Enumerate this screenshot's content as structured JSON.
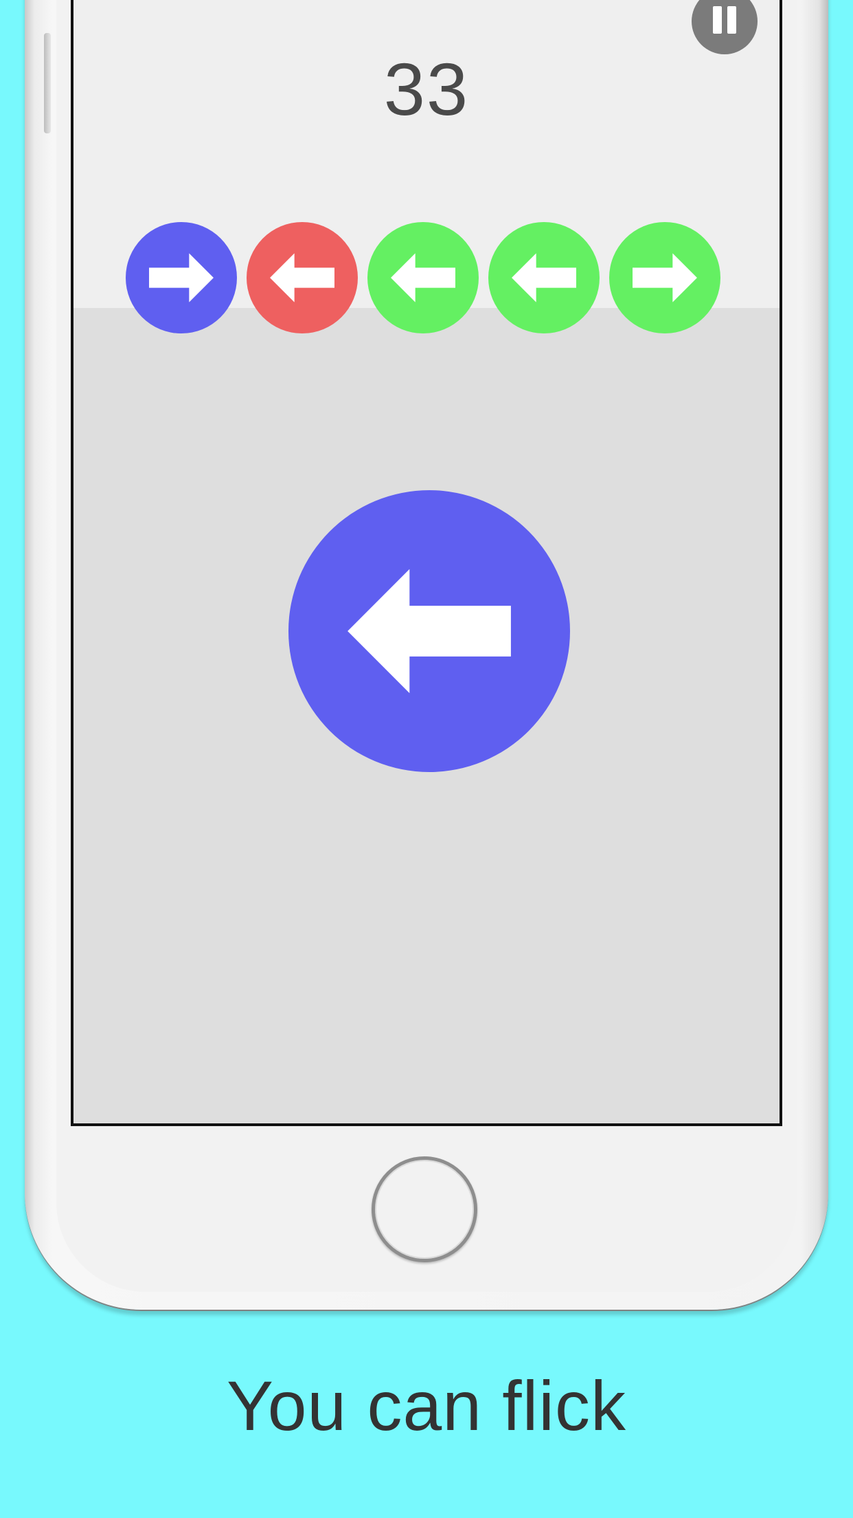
{
  "game": {
    "score": "33",
    "pause_icon": "pause-icon",
    "queue": [
      {
        "color": "#5f5ff0",
        "direction": "right"
      },
      {
        "color": "#ee6060",
        "direction": "left"
      },
      {
        "color": "#64f062",
        "direction": "left"
      },
      {
        "color": "#64f062",
        "direction": "left"
      },
      {
        "color": "#64f062",
        "direction": "right"
      }
    ],
    "current": {
      "color": "#5f5ff0",
      "direction": "left"
    }
  },
  "caption": "You can flick",
  "colors": {
    "background": "#78f9fd",
    "screen_top": "#efefef",
    "screen_bottom": "#dedede"
  }
}
